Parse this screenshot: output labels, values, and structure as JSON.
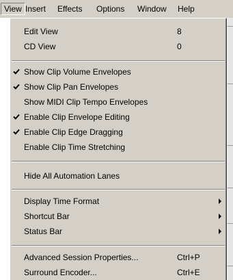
{
  "menubar": {
    "items": [
      {
        "label": "View",
        "active": true
      },
      {
        "label": "Insert"
      },
      {
        "label": "Effects"
      },
      {
        "label": "Options"
      },
      {
        "label": "Window"
      },
      {
        "label": "Help"
      }
    ]
  },
  "menu": {
    "items": [
      {
        "label": "Edit View",
        "shortcut": "8"
      },
      {
        "label": "CD View",
        "shortcut": "0"
      },
      {
        "label": "Show Clip Volume Envelopes",
        "checked": true
      },
      {
        "label": "Show Clip Pan Envelopes",
        "checked": true
      },
      {
        "label": "Show MIDI Clip Tempo Envelopes",
        "checked": false
      },
      {
        "label": "Enable Clip Envelope Editing",
        "checked": true
      },
      {
        "label": "Enable Clip Edge Dragging",
        "checked": true
      },
      {
        "label": "Enable Clip Time Stretching",
        "checked": false
      },
      {
        "label": "Hide All Automation Lanes"
      },
      {
        "label": "Display Time Format",
        "submenu": true
      },
      {
        "label": "Shortcut Bar",
        "submenu": true
      },
      {
        "label": "Status Bar",
        "submenu": true
      },
      {
        "label": "Advanced Session Properties...",
        "shortcut": "Ctrl+P"
      },
      {
        "label": "Surround Encoder...",
        "shortcut": "Ctrl+E"
      }
    ]
  }
}
